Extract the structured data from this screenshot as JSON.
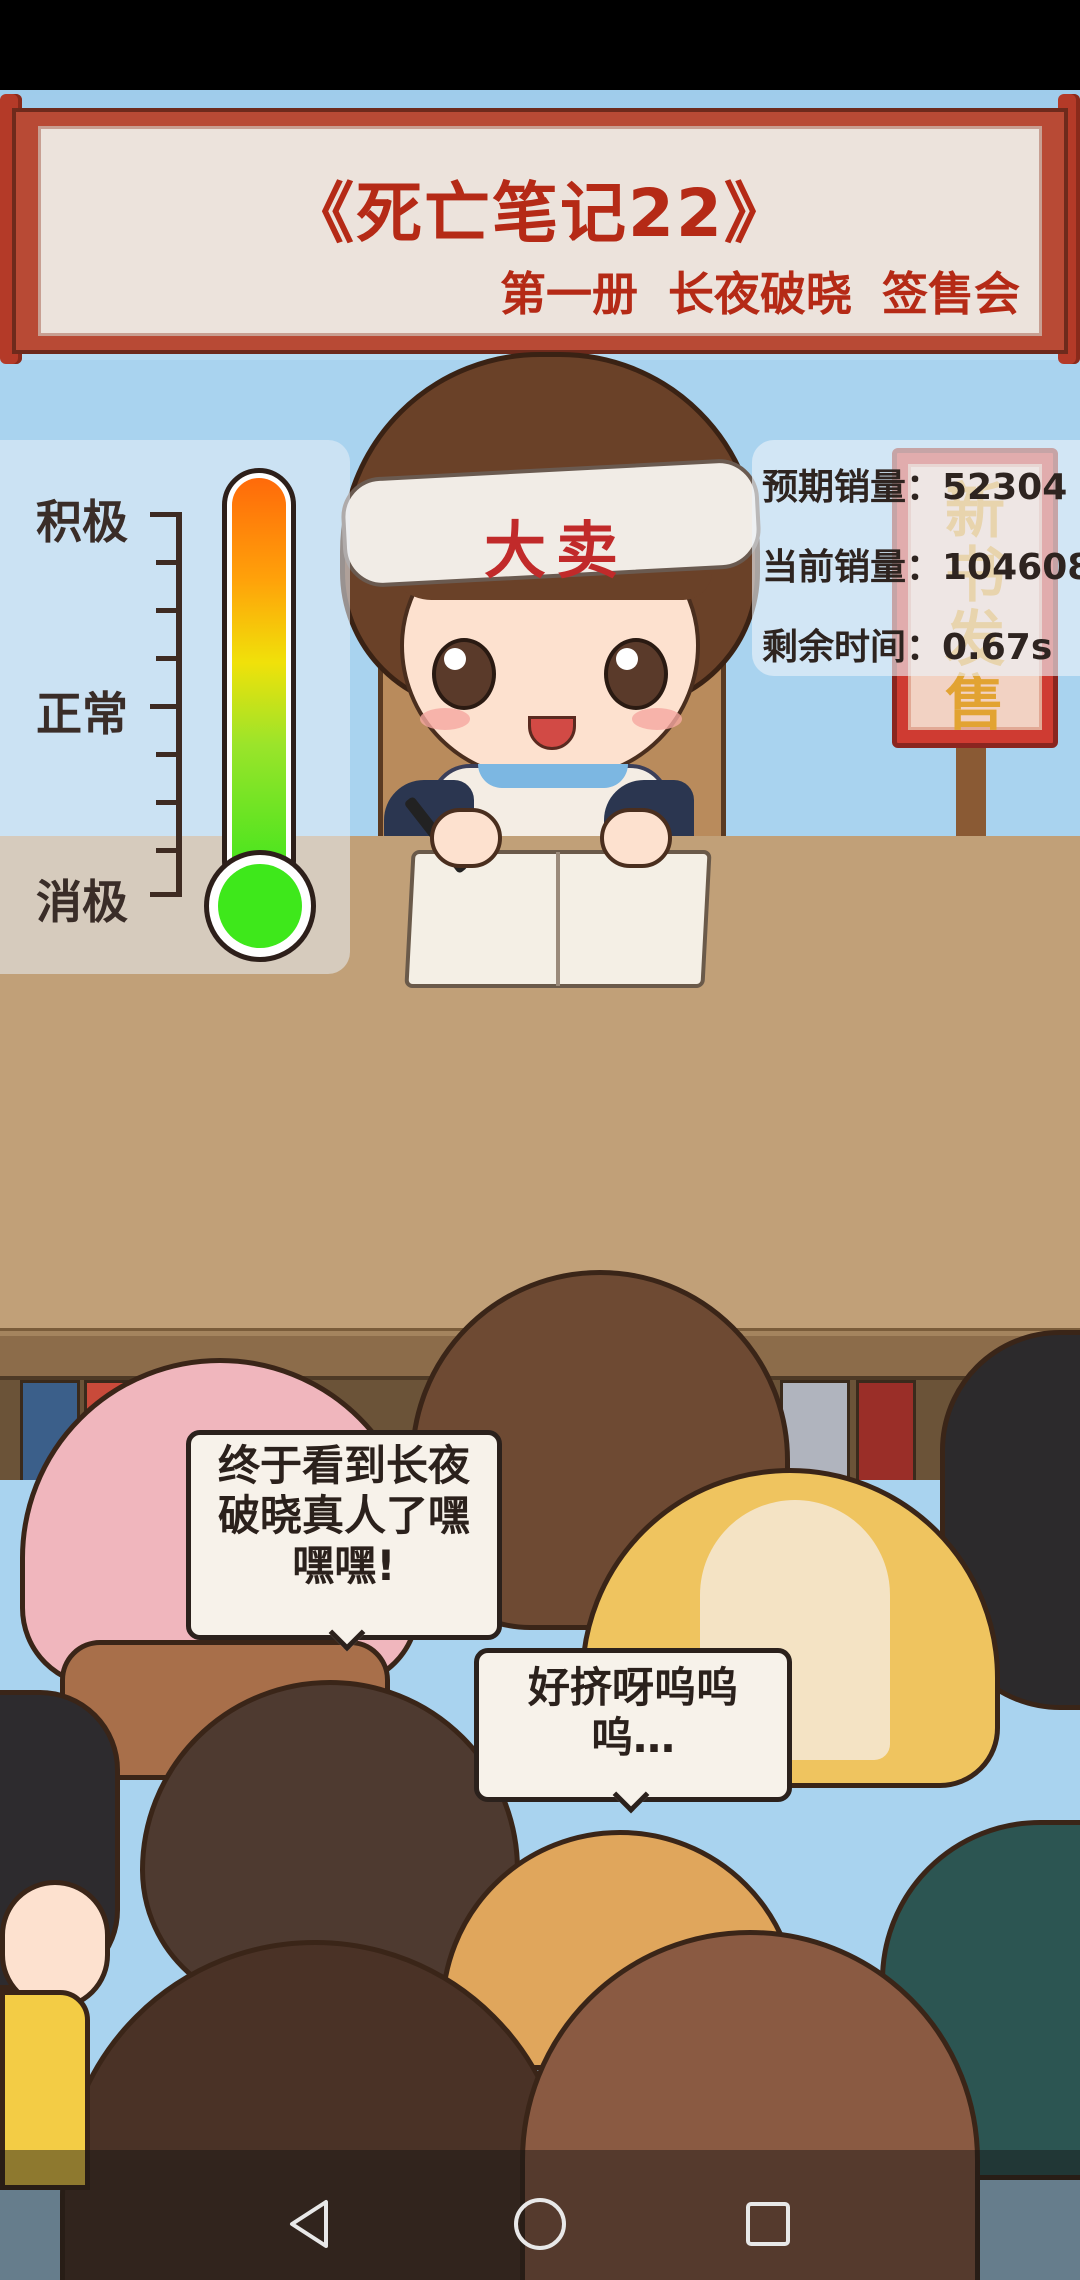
{
  "banner": {
    "title": "《死亡笔记22》",
    "subtitle": "第一册 长夜破晓 签售会"
  },
  "mood_meter": {
    "label_top": "积极",
    "label_mid": "正常",
    "label_bottom": "消极",
    "level": 1.0,
    "colors": [
      "#ff6a0a",
      "#f0e10a",
      "#3ae51c"
    ]
  },
  "stats": {
    "expected_sales": "预期销量：52304",
    "current_sales": "当前销量：104608",
    "time_left": "剩余时间：0.67s"
  },
  "author": {
    "headband_text": "大卖"
  },
  "sign": {
    "text": "新书发售"
  },
  "speech_bubbles": {
    "bubble1": "终于看到长夜破晓真人了嘿嘿嘿!",
    "bubble2": "好挤呀呜呜呜…"
  },
  "nav": {
    "back_icon": "triangle-back-icon",
    "home_icon": "circle-home-icon",
    "recents_icon": "square-recents-icon"
  }
}
